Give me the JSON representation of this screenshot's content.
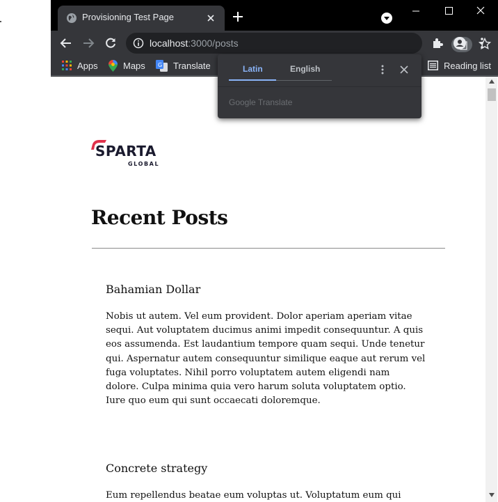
{
  "tab": {
    "title": "Provisioning Test Page"
  },
  "address": {
    "host": "localhost",
    "rest": ":3000/posts"
  },
  "bookmarks": [
    {
      "label": "Apps"
    },
    {
      "label": "Maps"
    },
    {
      "label": "Translate"
    }
  ],
  "reading_list": {
    "label": "Reading list"
  },
  "translate_popup": {
    "tabs": [
      "Latin",
      "English"
    ],
    "active_tab": "Latin",
    "powered_by": "Google Translate"
  },
  "page": {
    "logo_word": "SPARTA",
    "logo_sub": "GLOBAL",
    "heading": "Recent Posts",
    "posts": [
      {
        "title": "Bahamian Dollar",
        "body": "Nobis ut autem. Vel eum provident. Dolor aperiam aperiam vitae sequi. Aut voluptatem ducimus animi impedit consequuntur. A quis eos assumenda. Est laudantium tempore quam sequi. Unde tenetur qui. Aspernatur autem consequuntur similique eaque aut rerum vel fuga voluptates. Nihil porro voluptatem autem eligendi nam dolore. Culpa minima quia vero harum soluta voluptatem optio. Iure quo eum qui sunt occaecati doloremque."
      },
      {
        "title": "Concrete strategy",
        "body": "Eum repellendus beatae eum voluptas ut. Voluptatum eum qui nemo sed."
      }
    ]
  },
  "colors": {
    "accent_blue": "#8ab4f8",
    "logo_red": "#e0314b",
    "chrome_dark": "#35363a"
  }
}
